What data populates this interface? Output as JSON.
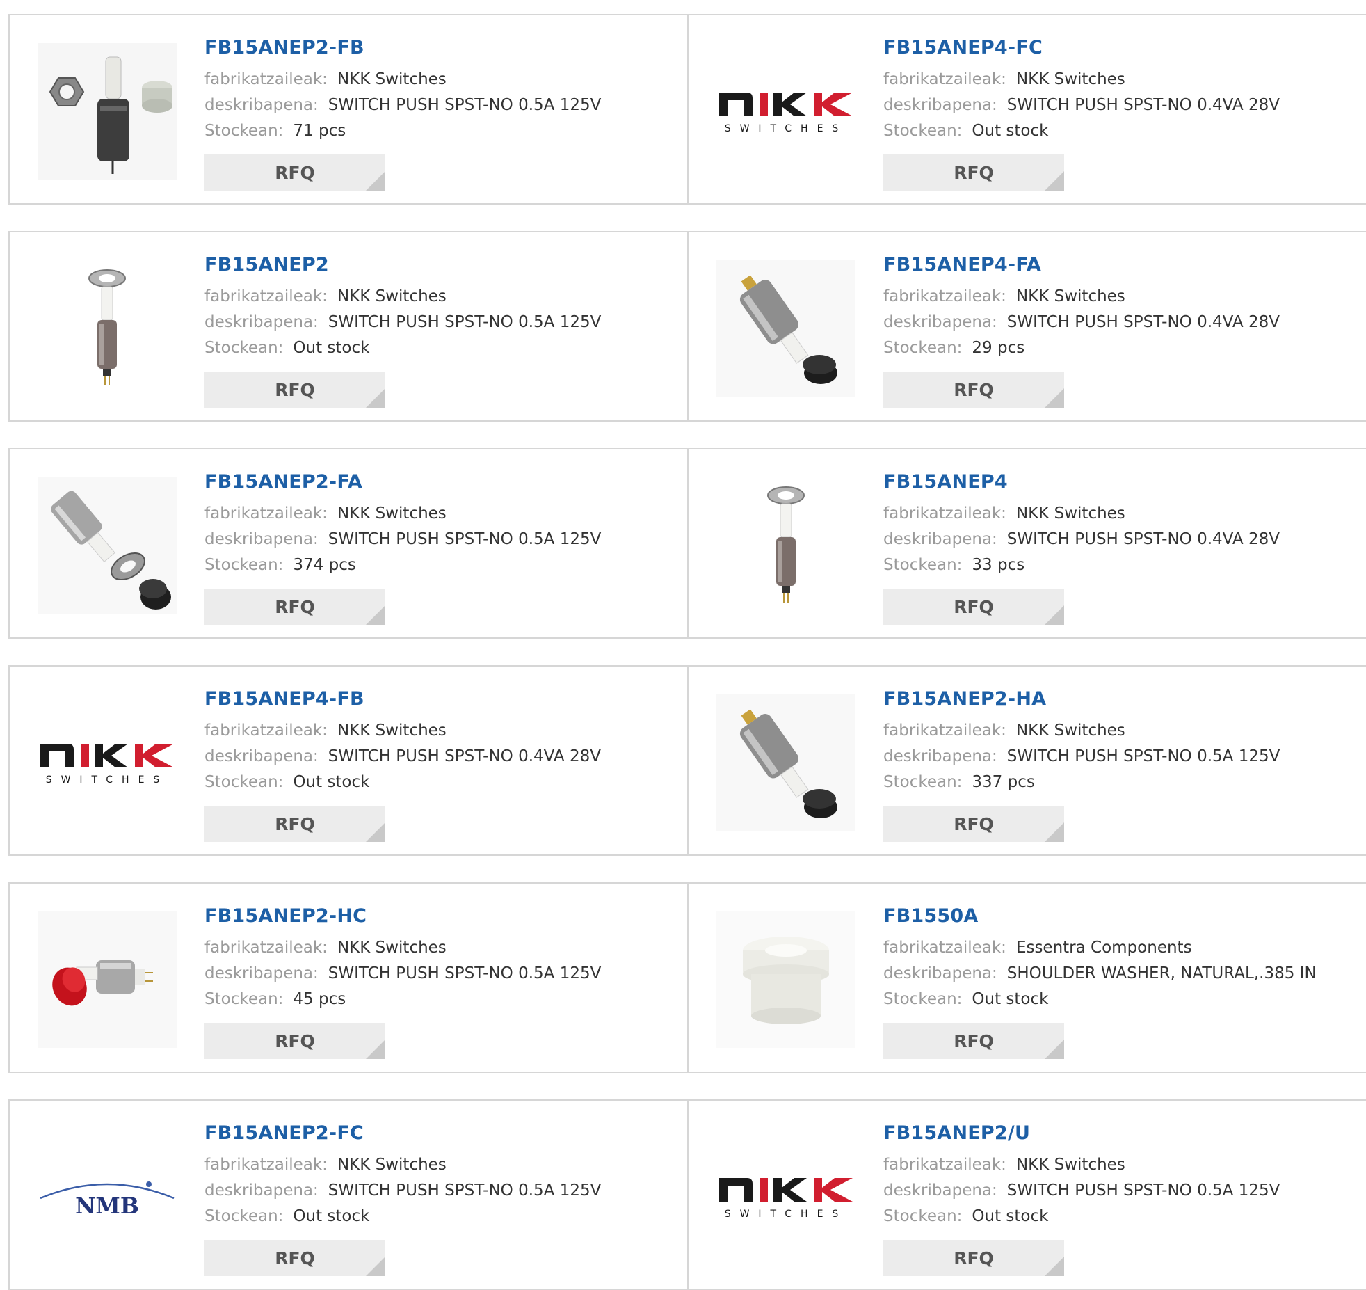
{
  "labels": {
    "manufacturer": "fabrikatzaileak:",
    "description": "deskribapena:",
    "stock": "Stockean:",
    "rfq": "RFQ"
  },
  "colors": {
    "link": "#1d5fa6",
    "label": "#9a9a9a",
    "value": "#333333",
    "button_bg": "#ececec"
  },
  "products": [
    {
      "name": "FB15ANEP2-FB",
      "manufacturer": "NKK Switches",
      "description": "SWITCH PUSH SPST-NO 0.5A 125V",
      "stock": "71 pcs",
      "image": "switch-white-nut-cap"
    },
    {
      "name": "FB15ANEP4-FC",
      "manufacturer": "NKK Switches",
      "description": "SWITCH PUSH SPST-NO 0.4VA 28V",
      "stock": "Out stock",
      "image": "nkk-logo"
    },
    {
      "name": "FB15ANEP2",
      "manufacturer": "NKK Switches",
      "description": "SWITCH PUSH SPST-NO 0.5A 125V",
      "stock": "Out stock",
      "image": "switch-vertical"
    },
    {
      "name": "FB15ANEP4-FA",
      "manufacturer": "NKK Switches",
      "description": "SWITCH PUSH SPST-NO 0.4VA 28V",
      "stock": "29 pcs",
      "image": "switch-black-cap-diagonal"
    },
    {
      "name": "FB15ANEP2-FA",
      "manufacturer": "NKK Switches",
      "description": "SWITCH PUSH SPST-NO 0.5A 125V",
      "stock": "374 pcs",
      "image": "switch-exploded-black-cap"
    },
    {
      "name": "FB15ANEP4",
      "manufacturer": "NKK Switches",
      "description": "SWITCH PUSH SPST-NO 0.4VA 28V",
      "stock": "33 pcs",
      "image": "switch-vertical"
    },
    {
      "name": "FB15ANEP4-FB",
      "manufacturer": "NKK Switches",
      "description": "SWITCH PUSH SPST-NO 0.4VA 28V",
      "stock": "Out stock",
      "image": "nkk-logo"
    },
    {
      "name": "FB15ANEP2-HA",
      "manufacturer": "NKK Switches",
      "description": "SWITCH PUSH SPST-NO 0.5A 125V",
      "stock": "337 pcs",
      "image": "switch-black-cap-diagonal"
    },
    {
      "name": "FB15ANEP2-HC",
      "manufacturer": "NKK Switches",
      "description": "SWITCH PUSH SPST-NO 0.5A 125V",
      "stock": "45 pcs",
      "image": "switch-red-cap"
    },
    {
      "name": "FB1550A",
      "manufacturer": "Essentra Components",
      "description": "SHOULDER WASHER, NATURAL,.385 IN",
      "stock": "Out stock",
      "image": "shoulder-washer"
    },
    {
      "name": "FB15ANEP2-FC",
      "manufacturer": "NKK Switches",
      "description": "SWITCH PUSH SPST-NO 0.5A 125V",
      "stock": "Out stock",
      "image": "nmb-logo"
    },
    {
      "name": "FB15ANEP2/U",
      "manufacturer": "NKK Switches",
      "description": "SWITCH PUSH SPST-NO 0.5A 125V",
      "stock": "Out stock",
      "image": "nkk-logo"
    }
  ],
  "logos": {
    "nkk_top": "nkk",
    "nkk_bottom": "SWITCHES",
    "nmb": "NMB"
  }
}
